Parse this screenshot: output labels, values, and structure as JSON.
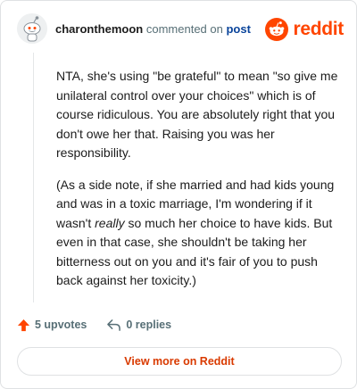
{
  "comment": {
    "username": "charonthemoon",
    "action_text": "commented on",
    "target_link": "post",
    "brand": "reddit",
    "brand_color": "#ff4500",
    "paragraph_1": "NTA, she's using \"be grateful\" to mean \"so give me unilateral control over your choices\" which is of course ridiculous. You are absolutely right that you don't owe her that. Raising you was her responsibility.",
    "paragraph_2_before": "(As a side note, if she married and had kids young and was in a toxic marriage, I'm wondering if it wasn't ",
    "paragraph_2_emphasis": "really",
    "paragraph_2_after": " so much her choice to have kids. But even in that case, she shouldn't be taking her bitterness out on you and it's fair of you to push back against her toxicity.)"
  },
  "footer": {
    "upvotes_label": "5 upvotes",
    "replies_label": "0 replies",
    "view_more_label": "View more on Reddit"
  }
}
